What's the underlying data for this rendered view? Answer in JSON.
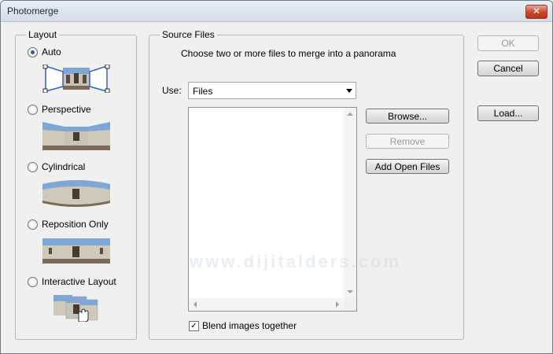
{
  "window": {
    "title": "Photomerge",
    "close_glyph": "✕"
  },
  "layout": {
    "legend": "Layout",
    "options": [
      {
        "label": "Auto",
        "selected": true
      },
      {
        "label": "Perspective",
        "selected": false
      },
      {
        "label": "Cylindrical",
        "selected": false
      },
      {
        "label": "Reposition Only",
        "selected": false
      },
      {
        "label": "Interactive Layout",
        "selected": false
      }
    ]
  },
  "source": {
    "legend": "Source Files",
    "instruction": "Choose two or more files to merge into a panorama",
    "use_label": "Use:",
    "use_value": "Files",
    "browse": "Browse...",
    "remove": "Remove",
    "add_open_files": "Add Open Files",
    "blend_label": "Blend images together",
    "blend_checked": true
  },
  "actions": {
    "ok": "OK",
    "cancel": "Cancel",
    "load": "Load..."
  },
  "watermark": "www.dijitalders.com",
  "colors": {
    "accent": "#2a5f9e",
    "selection_frame": "#2f5fd0"
  }
}
